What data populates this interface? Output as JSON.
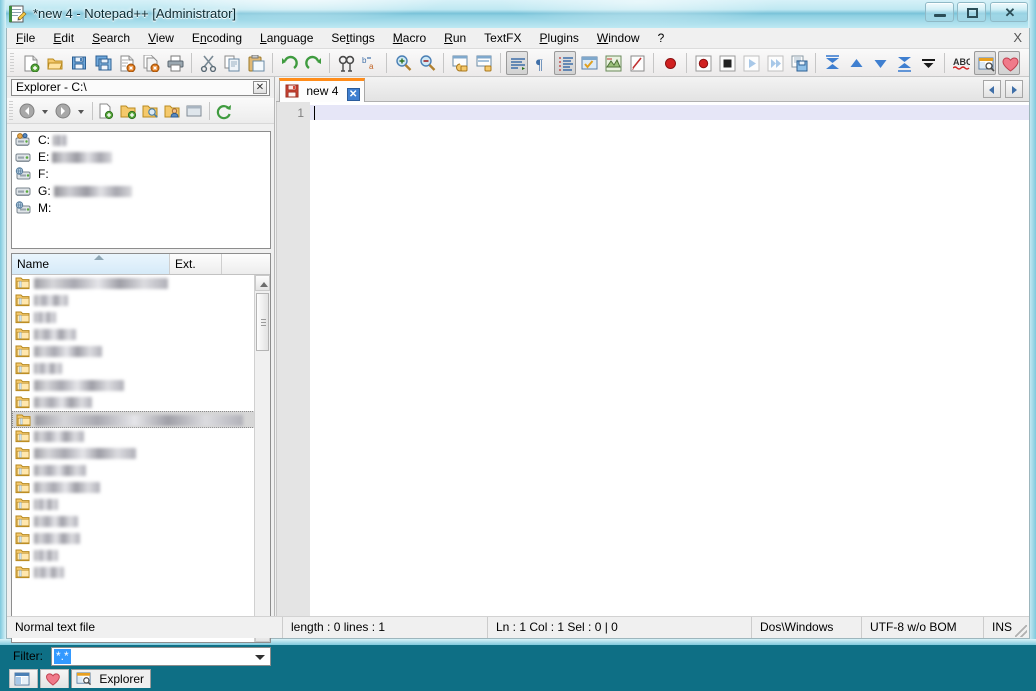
{
  "window": {
    "title": "*new  4 - Notepad++ [Administrator]",
    "icon": "notepad-plus-plus-icon",
    "controls": {
      "minimize": "–",
      "maximize": "□",
      "close": "✕"
    }
  },
  "menubar": {
    "items": [
      {
        "name": "file",
        "label": "File",
        "accel": "F"
      },
      {
        "name": "edit",
        "label": "Edit",
        "accel": "E"
      },
      {
        "name": "search",
        "label": "Search",
        "accel": "S"
      },
      {
        "name": "view",
        "label": "View",
        "accel": "V"
      },
      {
        "name": "encoding",
        "label": "Encoding",
        "accel": "n"
      },
      {
        "name": "language",
        "label": "Language",
        "accel": "L"
      },
      {
        "name": "settings",
        "label": "Settings",
        "accel": "t"
      },
      {
        "name": "macro",
        "label": "Macro",
        "accel": "M"
      },
      {
        "name": "run",
        "label": "Run",
        "accel": "R"
      },
      {
        "name": "textfx",
        "label": "TextFX",
        "accel": ""
      },
      {
        "name": "plugins",
        "label": "Plugins",
        "accel": "P"
      },
      {
        "name": "window",
        "label": "Window",
        "accel": "W"
      },
      {
        "name": "help",
        "label": "?",
        "accel": ""
      }
    ],
    "close_document_label": "X"
  },
  "toolbar": {
    "buttons": [
      "new-file-icon",
      "open-file-icon",
      "save-icon",
      "save-all-icon",
      "close-file-icon",
      "close-all-files-icon",
      "print-icon",
      "sep",
      "cut-icon",
      "copy-icon",
      "paste-icon",
      "sep",
      "undo-icon",
      "redo-icon",
      "sep",
      "find-icon",
      "replace-icon",
      "sep",
      "zoom-in-icon",
      "zoom-out-icon",
      "sep",
      "sync-vertical-scroll-icon",
      "sync-horizontal-scroll-icon",
      "sep",
      "word-wrap-icon",
      "show-all-characters-icon",
      "indent-guideline-icon",
      "user-defined-dialog-icon",
      "document-map-icon",
      "function-list-icon",
      "sep",
      "start-record-macro-icon",
      "sep",
      "record-icon",
      "stop-record-icon",
      "playback-icon",
      "run-multiple-macro-icon",
      "save-macro-icon",
      "sep",
      "bookmark-first-icon",
      "bookmark-previous-icon",
      "bookmark-next-icon",
      "bookmark-last-icon",
      "clear-bookmarks-icon",
      "sep",
      "spell-check-icon",
      "explorer-panel-icon",
      "favorites-icon",
      "hex-editor-icon",
      "folder-capture-icon",
      "spell-check-doc-icon"
    ],
    "pressed": [
      "word-wrap-icon",
      "indent-guideline-icon",
      "explorer-panel-icon",
      "favorites-icon"
    ]
  },
  "explorer": {
    "caption": "Explorer - C:\\",
    "caption_close": "✕",
    "toolbar": [
      "back-icon",
      "back-dropdown-icon",
      "forward-icon",
      "forward-dropdown-icon",
      "sep",
      "new-file-icon",
      "new-folder-icon",
      "open-folder-icon",
      "folder-user-icon",
      "folder-window-icon",
      "sep",
      "refresh-icon"
    ],
    "drives": [
      {
        "label": "C:",
        "icon": "shared-drive-icon",
        "redacted_width": 14
      },
      {
        "label": "E:",
        "icon": "local-drive-icon",
        "redacted_width": 60
      },
      {
        "label": "F:",
        "icon": "network-drive-icon",
        "redacted_width": 0
      },
      {
        "label": "G:",
        "icon": "local-drive-icon",
        "redacted_width": 78
      },
      {
        "label": "M:",
        "icon": "network-drive-icon",
        "redacted_width": 0
      }
    ],
    "filelist": {
      "columns": [
        {
          "name": "name",
          "label": "Name",
          "sorted": "asc"
        },
        {
          "name": "ext",
          "label": "Ext.",
          "sorted": ""
        },
        {
          "name": "blank",
          "label": "",
          "sorted": ""
        }
      ],
      "rows": [
        {
          "icon": "folder-icon",
          "redacted_width": 134,
          "selected": false
        },
        {
          "icon": "folder-icon",
          "redacted_width": 34,
          "selected": false
        },
        {
          "icon": "folder-icon",
          "redacted_width": 22,
          "selected": false
        },
        {
          "icon": "folder-icon",
          "redacted_width": 42,
          "selected": false
        },
        {
          "icon": "folder-icon",
          "redacted_width": 68,
          "selected": false
        },
        {
          "icon": "folder-icon",
          "redacted_width": 28,
          "selected": false
        },
        {
          "icon": "folder-icon",
          "redacted_width": 90,
          "selected": false
        },
        {
          "icon": "folder-icon",
          "redacted_width": 58,
          "selected": false
        },
        {
          "icon": "folder-icon",
          "redacted_width": 208,
          "selected": true
        },
        {
          "icon": "folder-icon",
          "redacted_width": 50,
          "selected": false
        },
        {
          "icon": "folder-icon",
          "redacted_width": 102,
          "selected": false
        },
        {
          "icon": "folder-icon",
          "redacted_width": 52,
          "selected": false
        },
        {
          "icon": "folder-icon",
          "redacted_width": 66,
          "selected": false
        },
        {
          "icon": "folder-icon",
          "redacted_width": 24,
          "selected": false
        },
        {
          "icon": "folder-icon",
          "redacted_width": 44,
          "selected": false
        },
        {
          "icon": "folder-icon",
          "redacted_width": 46,
          "selected": false
        },
        {
          "icon": "folder-icon",
          "redacted_width": 24,
          "selected": false
        },
        {
          "icon": "folder-icon",
          "redacted_width": 30,
          "selected": false
        }
      ]
    },
    "filter": {
      "label": "Filter:",
      "value": "*.*"
    },
    "dock_tabs": [
      {
        "name": "project-panel",
        "icon": "project-panel-icon",
        "label": "",
        "active": false
      },
      {
        "name": "favorites",
        "icon": "favorites-heart-icon",
        "label": "",
        "active": false
      },
      {
        "name": "explorer",
        "icon": "explorer-panel-icon",
        "label": "Explorer",
        "active": true
      }
    ]
  },
  "editor": {
    "tab": {
      "label": "new  4",
      "icon": "unsaved-document-icon",
      "close": "✕",
      "modified": true
    },
    "tab_scroll_left": "◀",
    "tab_scroll_right": "▶",
    "line_numbers": [
      "1"
    ],
    "content": ""
  },
  "statusbar": {
    "file_type": "Normal text file",
    "length_lines": "length : 0   lines : 1",
    "position": "Ln : 1   Col : 1   Sel : 0 | 0",
    "eol": "Dos\\Windows",
    "encoding": "UTF-8 w/o BOM",
    "insert_mode": "INS"
  },
  "colors": {
    "accent_orange": "#ff8c1a",
    "selection_blue": "#3399ff",
    "caret_line": "#e6e6f7",
    "titlebar_glass": "#bfe9f2"
  }
}
